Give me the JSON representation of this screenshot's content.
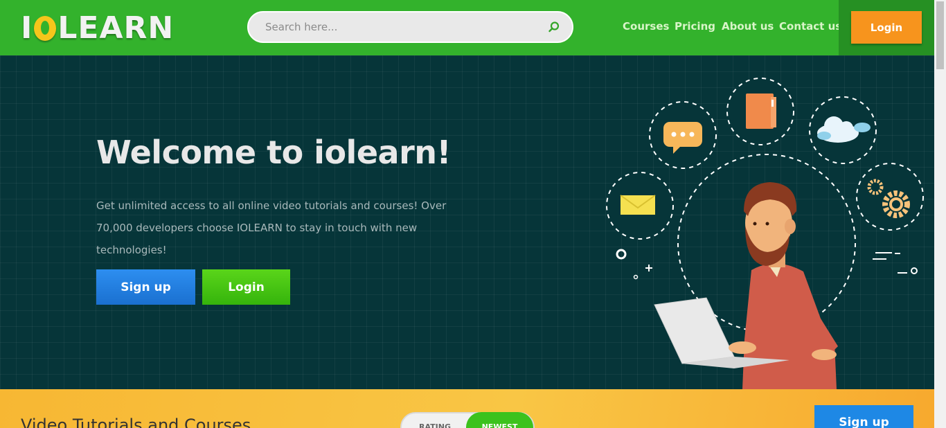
{
  "header": {
    "logo": {
      "before": "I",
      "after": "LEARN"
    },
    "search": {
      "placeholder": "Search here..."
    },
    "nav": [
      "Courses",
      "Pricing",
      "About us",
      "Contact us"
    ],
    "login_label": "Login",
    "colors": {
      "header": "#33b22c",
      "login_box": "#269023",
      "login_button": "#f7941d"
    }
  },
  "hero": {
    "title": "Welcome to iolearn!",
    "text": "Get unlimited access to all online video tutorials and courses! Over 70,000 developers choose IOLEARN to stay in touch with new technologies!",
    "signup_label": "Sign up",
    "login_label": "Login",
    "illustration_icons": [
      "chat-bubble-icon",
      "folder-icon",
      "cloud-icon",
      "mail-icon",
      "gears-icon",
      "developer-with-laptop"
    ]
  },
  "strip": {
    "title": "Video Tutorials and Courses",
    "toggle": {
      "option1": "RATING",
      "option2": "NEWEST",
      "selected": "NEWEST"
    },
    "signup_label": "Sign up"
  }
}
